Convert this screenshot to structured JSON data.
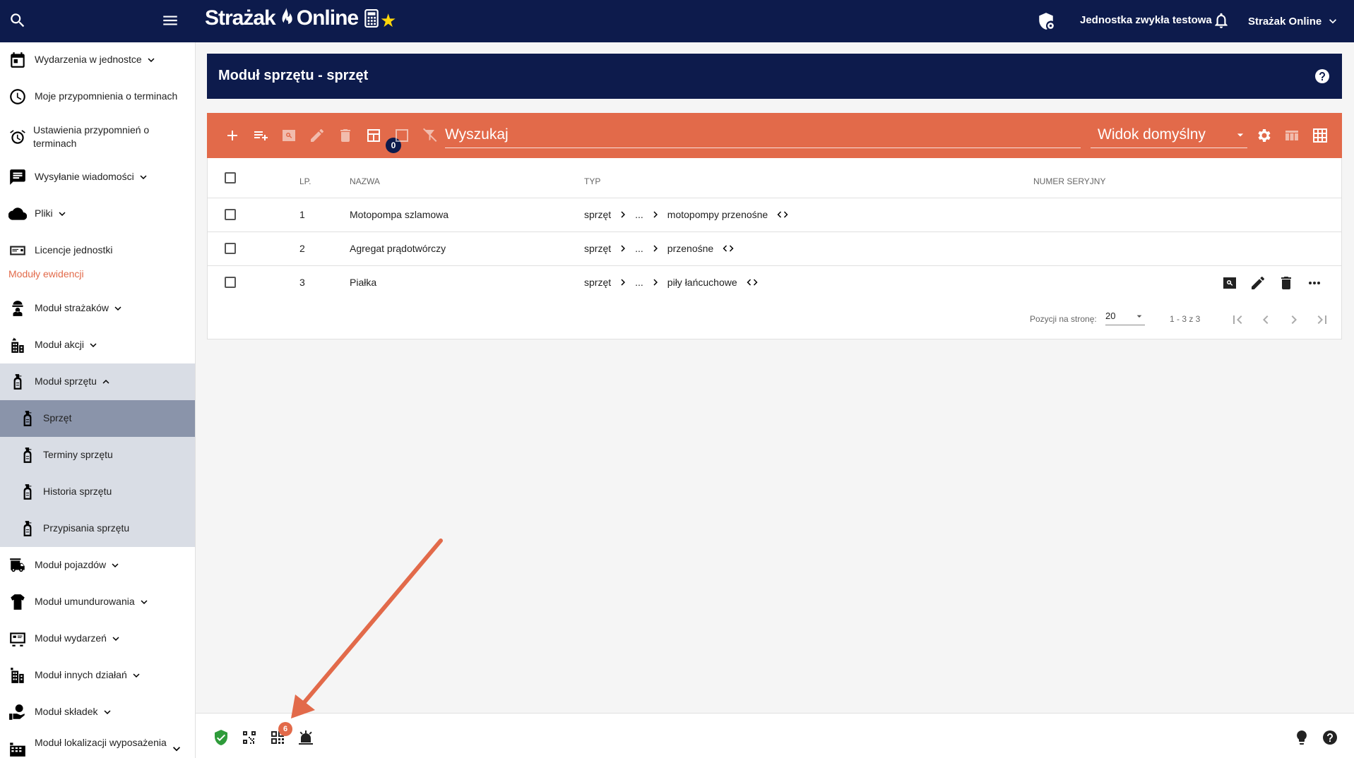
{
  "app": {
    "logo_left": "Strażak",
    "logo_right": "Online",
    "unit_name": "Jednostka zwykła testowa",
    "user_name": "Strażak Online"
  },
  "sidebar": {
    "items": [
      {
        "label": "Wydarzenia w jednostce",
        "icon": "calendar-icon",
        "expandable": true
      },
      {
        "label": "Moje przypomnienia o terminach",
        "icon": "clock-icon",
        "expandable": false
      },
      {
        "label": "Ustawienia przypomnień o terminach",
        "icon": "alarm-settings-icon",
        "expandable": false
      },
      {
        "label": "Wysyłanie wiadomości",
        "icon": "message-icon",
        "expandable": true
      },
      {
        "label": "Pliki",
        "icon": "cloud-icon",
        "expandable": true
      },
      {
        "label": "Licencje jednostki",
        "icon": "license-icon",
        "expandable": false
      }
    ],
    "section_header": "Moduły ewidencji",
    "modules": [
      {
        "label": "Moduł strażaków",
        "icon": "firefighter-icon",
        "expanded": false
      },
      {
        "label": "Moduł akcji",
        "icon": "building-fire-icon",
        "expanded": false
      },
      {
        "label": "Moduł sprzętu",
        "icon": "extinguisher-icon",
        "expanded": true
      }
    ],
    "sub_items": [
      {
        "label": "Sprzęt",
        "icon": "extinguisher-icon",
        "active": true
      },
      {
        "label": "Terminy sprzętu",
        "icon": "extinguisher-icon",
        "active": false
      },
      {
        "label": "Historia sprzętu",
        "icon": "extinguisher-icon",
        "active": false
      },
      {
        "label": "Przypisania sprzętu",
        "icon": "extinguisher-icon",
        "active": false
      }
    ],
    "modules_after": [
      {
        "label": "Moduł pojazdów",
        "icon": "truck-icon"
      },
      {
        "label": "Moduł umundurowania",
        "icon": "uniform-icon"
      },
      {
        "label": "Moduł wydarzeń",
        "icon": "event-icon"
      },
      {
        "label": "Moduł innych działań",
        "icon": "building-icon"
      },
      {
        "label": "Moduł składek",
        "icon": "hand-money-icon"
      },
      {
        "label": "Moduł lokalizacji wyposażenia",
        "icon": "location-icon"
      }
    ]
  },
  "main": {
    "title": "Moduł sprzętu - sprzęt",
    "toolbar": {
      "search_placeholder": "Wyszukaj",
      "view_selected": "Widok domyślny",
      "selected_count": "0"
    },
    "columns": {
      "lp": "LP.",
      "name": "NAZWA",
      "type": "TYP",
      "serial": "NUMER SERYJNY"
    },
    "rows": [
      {
        "lp": "1",
        "name": "Motopompa szlamowa",
        "type_root": "sprzęt",
        "type_ellipsis": "...",
        "type_leaf": "motopompy przenośne"
      },
      {
        "lp": "2",
        "name": "Agregat prądotwórczy",
        "type_root": "sprzęt",
        "type_ellipsis": "...",
        "type_leaf": "przenośne"
      },
      {
        "lp": "3",
        "name": "Piałka",
        "type_root": "sprzęt",
        "type_ellipsis": "...",
        "type_leaf": "piły łańcuchowe"
      }
    ],
    "pager": {
      "label": "Pozycji na stronę:",
      "page_size": "20",
      "range": "1 - 3 z 3"
    }
  },
  "footer": {
    "qr_badge": "6"
  },
  "colors": {
    "navy": "#0d1b4c",
    "accent": "#e26a4a",
    "active": "#8a94aa",
    "group_bg": "#d9dde5"
  }
}
